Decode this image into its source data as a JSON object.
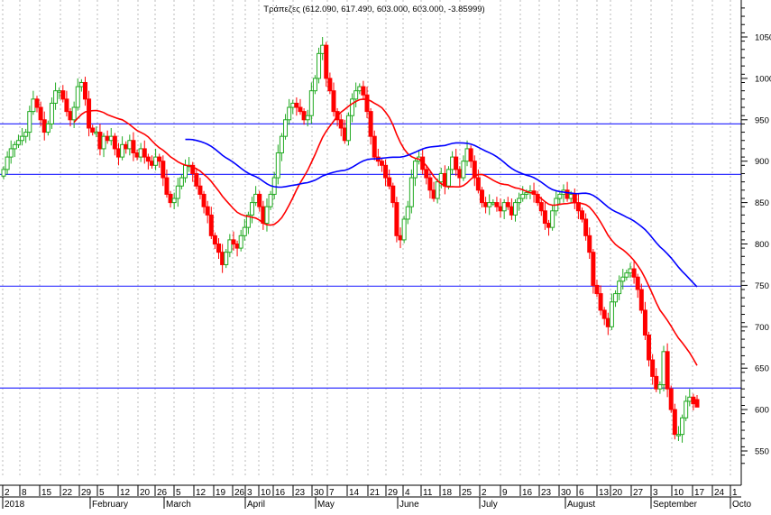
{
  "chart_data": {
    "type": "candlestick",
    "title": "Τράπεζες (612.090, 617.490, 603.000, 603.000, -3.85999)",
    "y_ticks": [
      1050,
      1000,
      950,
      900,
      850,
      800,
      750,
      700,
      650,
      600,
      550
    ],
    "ylim": [
      535,
      1088
    ],
    "grid": "vertical dashed",
    "week_labels": [
      "2",
      "8",
      "15",
      "22",
      "29",
      "5",
      "12",
      "20",
      "26",
      "5",
      "12",
      "19",
      "26",
      "3",
      "10",
      "16",
      "23",
      "30",
      "7",
      "14",
      "21",
      "29",
      "4",
      "11",
      "18",
      "25",
      "2",
      "9",
      "16",
      "23",
      "30",
      "6",
      "13",
      "20",
      "27",
      "3",
      "10",
      "17",
      "24",
      "1"
    ],
    "month_labels": [
      "2018",
      "February",
      "March",
      "April",
      "May",
      "June",
      "July",
      "August",
      "September",
      "Octo"
    ],
    "horizontal_levels": [
      945,
      884,
      749,
      626
    ],
    "moving_averages": [
      {
        "name": "MA20",
        "period": 20,
        "color": "#ff0000"
      },
      {
        "name": "MA50",
        "period": 50,
        "color": "#0000ff"
      }
    ],
    "colors": {
      "up": "#22aa22",
      "down": "#ff0000",
      "level": "#3333ff"
    },
    "last_candle": {
      "open": 612.09,
      "high": 617.49,
      "low": 603.0,
      "close": 603.0,
      "change": -3.85999
    },
    "close": [
      890,
      905,
      915,
      920,
      925,
      930,
      935,
      960,
      975,
      965,
      950,
      935,
      945,
      970,
      985,
      985,
      975,
      960,
      950,
      965,
      990,
      995,
      975,
      940,
      935,
      935,
      915,
      930,
      925,
      930,
      915,
      905,
      920,
      915,
      925,
      910,
      905,
      915,
      905,
      900,
      895,
      905,
      900,
      880,
      860,
      850,
      855,
      870,
      880,
      895,
      895,
      885,
      870,
      860,
      845,
      835,
      810,
      800,
      790,
      775,
      790,
      805,
      800,
      795,
      810,
      820,
      835,
      850,
      860,
      845,
      825,
      845,
      860,
      880,
      910,
      930,
      950,
      965,
      970,
      965,
      960,
      950,
      955,
      985,
      1000,
      1030,
      1040,
      1000,
      985,
      960,
      950,
      940,
      925,
      955,
      975,
      985,
      990,
      980,
      960,
      930,
      905,
      900,
      895,
      880,
      870,
      850,
      810,
      805,
      830,
      845,
      880,
      900,
      905,
      890,
      880,
      865,
      855,
      875,
      885,
      870,
      890,
      905,
      890,
      880,
      900,
      915,
      900,
      880,
      865,
      850,
      845,
      850,
      850,
      845,
      840,
      850,
      845,
      835,
      850,
      855,
      860,
      862,
      864,
      860,
      850,
      840,
      825,
      820,
      840,
      855,
      860,
      865,
      855,
      860,
      850,
      840,
      830,
      810,
      790,
      750,
      740,
      720,
      710,
      700,
      730,
      740,
      755,
      760,
      765,
      770,
      760,
      745,
      720,
      690,
      660,
      640,
      625,
      630,
      670,
      625,
      600,
      570,
      570,
      590,
      610,
      615,
      607,
      603
    ]
  }
}
